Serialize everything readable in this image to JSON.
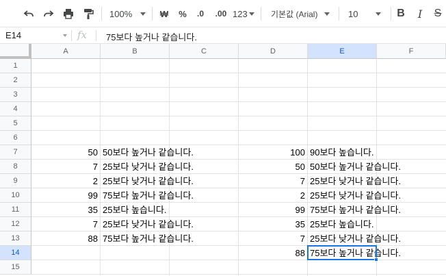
{
  "toolbar": {
    "zoom": "100%",
    "currency": "₩",
    "percent": "%",
    "dec_decrease": ".0",
    "dec_increase": ".00",
    "more_formats": "123",
    "font_family": "기본값 (Arial)",
    "font_size": "10",
    "bold": "B",
    "italic": "I",
    "strike": "S"
  },
  "formula_bar": {
    "name_box": "E14",
    "fx": "fx",
    "content": "75보다 높거나 같습니다."
  },
  "columns": [
    "A",
    "B",
    "C",
    "D",
    "E",
    "F"
  ],
  "rows": [
    "1",
    "2",
    "3",
    "4",
    "5",
    "6",
    "7",
    "8",
    "9",
    "10",
    "11",
    "12",
    "13",
    "14",
    "15"
  ],
  "sheet": {
    "col_a": [
      "50",
      "7",
      "2",
      "99",
      "35",
      "7",
      "88"
    ],
    "col_b": [
      "50보다 높거나 같습니다.",
      "25보다 낮거나 같습니다.",
      "25보다 낮거나 같습니다.",
      "75보다 높거나 같습니다.",
      "25보다 높습니다.",
      "25보다 낮거나 같습니다.",
      "75보다 높거나 같습니다."
    ],
    "col_d": [
      "100",
      "50",
      "7",
      "2",
      "99",
      "35",
      "7",
      "88"
    ],
    "col_e": [
      "90보다 높습니다.",
      "50보다 높거나 같습니다.",
      "25보다 낮거나 같습니다.",
      "25보다 낮거나 같습니다.",
      "75보다 높거나 같습니다.",
      "25보다 높습니다.",
      "25보다 낮거나 같습니다.",
      "75보다 높거나 같습니다."
    ]
  },
  "selected_cell": "E14",
  "colors": {
    "selection": "#1a73e8",
    "header_selected": "#d3e3fd"
  }
}
